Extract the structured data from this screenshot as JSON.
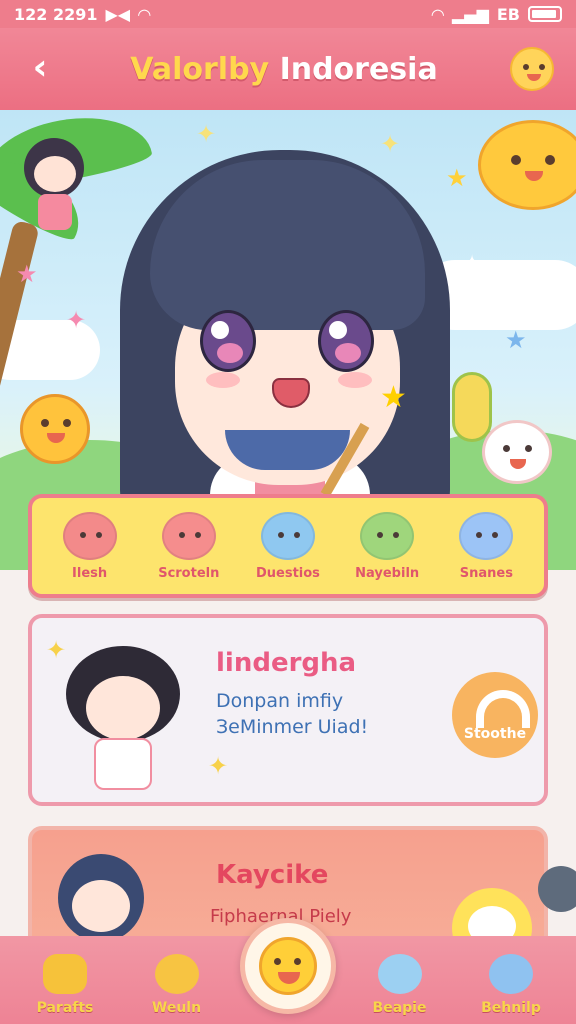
{
  "status_bar": {
    "time": "122 2291",
    "left_icons": [
      "nfc-icon",
      "wifi-icon"
    ],
    "network_label": "ЕВ",
    "right_icons": [
      "signal-icon",
      "battery-icon"
    ]
  },
  "header": {
    "title_part1": "Valorlby",
    "title_part2": "Indoresia",
    "back_icon": "chevron-left-icon",
    "mascot_icon": "sun-mascot-icon"
  },
  "categories": [
    {
      "label": "Ilesh",
      "icon": "sushi-icon",
      "color": "#f38a8a"
    },
    {
      "label": "Scroteln",
      "icon": "pink-blob-icon",
      "color": "#f58d8d"
    },
    {
      "label": "Duestios",
      "icon": "blue-bear-icon",
      "color": "#8fc8f0"
    },
    {
      "label": "Nayebiln",
      "icon": "green-bear-icon",
      "color": "#9fd67c"
    },
    {
      "label": "Snanes",
      "icon": "blue-star-icon",
      "color": "#9cc4f6"
    }
  ],
  "cards": [
    {
      "title": "lindergha",
      "line1": "Donpan imfiy",
      "line2": "ЗеMinmer Uiad!",
      "action_label": "Stoothe",
      "action_icon": "arc-icon"
    },
    {
      "title": "Kaycike",
      "line1": "Fiphaernal Piely"
    }
  ],
  "bottom_nav": [
    {
      "label": "Parafts",
      "icon": "house-icon",
      "color": "#f6c23a"
    },
    {
      "label": "Weuln",
      "icon": "chick-icon",
      "color": "#f7c442"
    },
    {
      "label": "Beapie",
      "icon": "bird-icon",
      "color": "#9cd0f2"
    },
    {
      "label": "Behnilp",
      "icon": "blue-bear-icon",
      "color": "#8fc2f0"
    }
  ],
  "center_button": {
    "icon": "smiley-icon"
  },
  "colors": {
    "primary_pink": "#ee7d8c",
    "accent_yellow": "#fde46d",
    "title_pink": "#ea5c84",
    "text_blue": "#3e71b4"
  }
}
